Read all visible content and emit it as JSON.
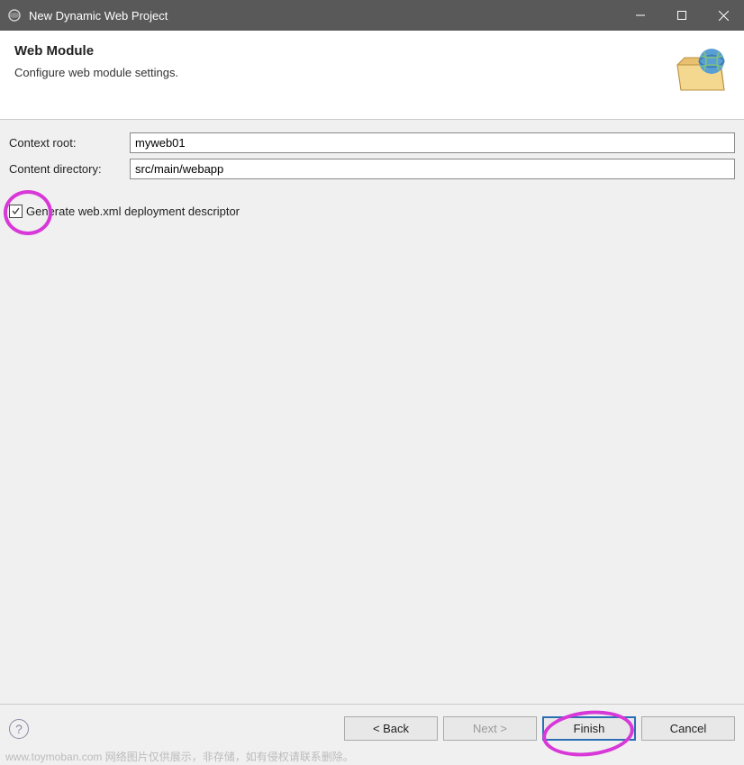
{
  "titlebar": {
    "title": "New Dynamic Web Project"
  },
  "header": {
    "title": "Web Module",
    "description": "Configure web module settings."
  },
  "form": {
    "context_root_label": "Context root:",
    "context_root_value": "myweb01",
    "content_directory_label": "Content directory:",
    "content_directory_value": "src/main/webapp",
    "generate_webxml_label": "Generate web.xml deployment descriptor",
    "generate_webxml_checked": true
  },
  "buttons": {
    "back": "< Back",
    "next": "Next >",
    "finish": "Finish",
    "cancel": "Cancel"
  },
  "watermark": "www.toymoban.com 网络图片仅供展示，非存储，如有侵权请联系删除。"
}
